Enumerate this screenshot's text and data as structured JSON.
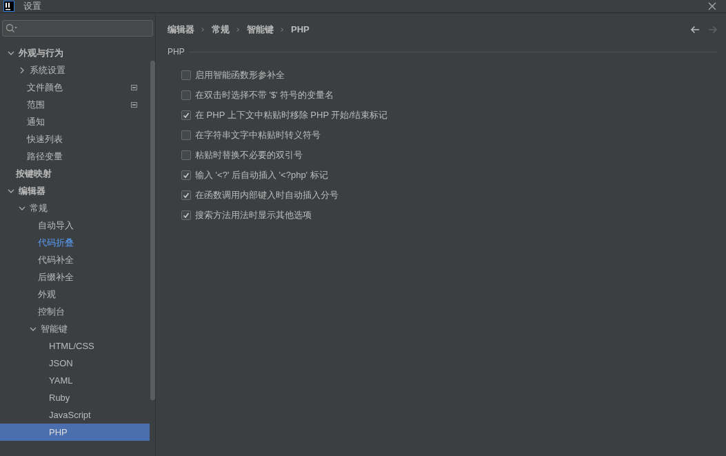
{
  "window": {
    "title": "设置"
  },
  "sidebar": {
    "items": [
      {
        "label": "外观与行为",
        "bold": true,
        "expanded": true,
        "selected": false,
        "modified": false,
        "scope_icon": false,
        "children": [
          {
            "label": "系统设置",
            "bold": false,
            "expanded": false,
            "selected": false,
            "modified": false,
            "scope_icon": false
          },
          {
            "label": "文件颜色",
            "bold": false,
            "selected": false,
            "modified": false,
            "scope_icon": true
          },
          {
            "label": "范围",
            "bold": false,
            "selected": false,
            "modified": false,
            "scope_icon": true
          },
          {
            "label": "通知",
            "bold": false,
            "selected": false,
            "modified": false,
            "scope_icon": false
          },
          {
            "label": "快速列表",
            "bold": false,
            "selected": false,
            "modified": false,
            "scope_icon": false
          },
          {
            "label": "路径变量",
            "bold": false,
            "selected": false,
            "modified": false,
            "scope_icon": false
          }
        ]
      },
      {
        "label": "按键映射",
        "bold": true,
        "selected": false,
        "modified": false,
        "scope_icon": false
      },
      {
        "label": "编辑器",
        "bold": true,
        "expanded": true,
        "selected": false,
        "modified": false,
        "scope_icon": false,
        "children": [
          {
            "label": "常规",
            "bold": false,
            "expanded": true,
            "selected": false,
            "modified": false,
            "scope_icon": false,
            "children": [
              {
                "label": "自动导入",
                "bold": false,
                "selected": false,
                "modified": false,
                "scope_icon": false
              },
              {
                "label": "代码折叠",
                "bold": false,
                "selected": false,
                "modified": true,
                "scope_icon": false
              },
              {
                "label": "代码补全",
                "bold": false,
                "selected": false,
                "modified": false,
                "scope_icon": false
              },
              {
                "label": "后缀补全",
                "bold": false,
                "selected": false,
                "modified": false,
                "scope_icon": false
              },
              {
                "label": "外观",
                "bold": false,
                "selected": false,
                "modified": false,
                "scope_icon": false
              },
              {
                "label": "控制台",
                "bold": false,
                "selected": false,
                "modified": false,
                "scope_icon": false
              },
              {
                "label": "智能键",
                "bold": false,
                "expanded": true,
                "selected": false,
                "modified": false,
                "scope_icon": false,
                "children": [
                  {
                    "label": "HTML/CSS",
                    "bold": false,
                    "selected": false,
                    "modified": false,
                    "scope_icon": false
                  },
                  {
                    "label": "JSON",
                    "bold": false,
                    "selected": false,
                    "modified": false,
                    "scope_icon": false
                  },
                  {
                    "label": "YAML",
                    "bold": false,
                    "selected": false,
                    "modified": false,
                    "scope_icon": false
                  },
                  {
                    "label": "Ruby",
                    "bold": false,
                    "selected": false,
                    "modified": false,
                    "scope_icon": false
                  },
                  {
                    "label": "JavaScript",
                    "bold": false,
                    "selected": false,
                    "modified": false,
                    "scope_icon": false
                  },
                  {
                    "label": "PHP",
                    "bold": false,
                    "selected": true,
                    "modified": false,
                    "scope_icon": false
                  }
                ]
              }
            ]
          }
        ]
      }
    ]
  },
  "breadcrumb": [
    "编辑器",
    "常规",
    "智能键",
    "PHP"
  ],
  "section": {
    "title": "PHP"
  },
  "options": [
    {
      "label": "启用智能函数形参补全",
      "checked": false
    },
    {
      "label": "在双击时选择不带 '$' 符号的变量名",
      "checked": false
    },
    {
      "label": "在 PHP 上下文中粘贴时移除 PHP 开始/结束标记",
      "checked": true
    },
    {
      "label": "在字符串文字中粘贴时转义符号",
      "checked": false
    },
    {
      "label": "粘贴时替换不必要的双引号",
      "checked": false
    },
    {
      "label": "输入 '<?' 后自动插入 '<?php' 标记",
      "checked": true
    },
    {
      "label": "在函数调用内部键入时自动插入分号",
      "checked": true
    },
    {
      "label": "搜索方法用法时显示其他选项",
      "checked": true
    }
  ]
}
